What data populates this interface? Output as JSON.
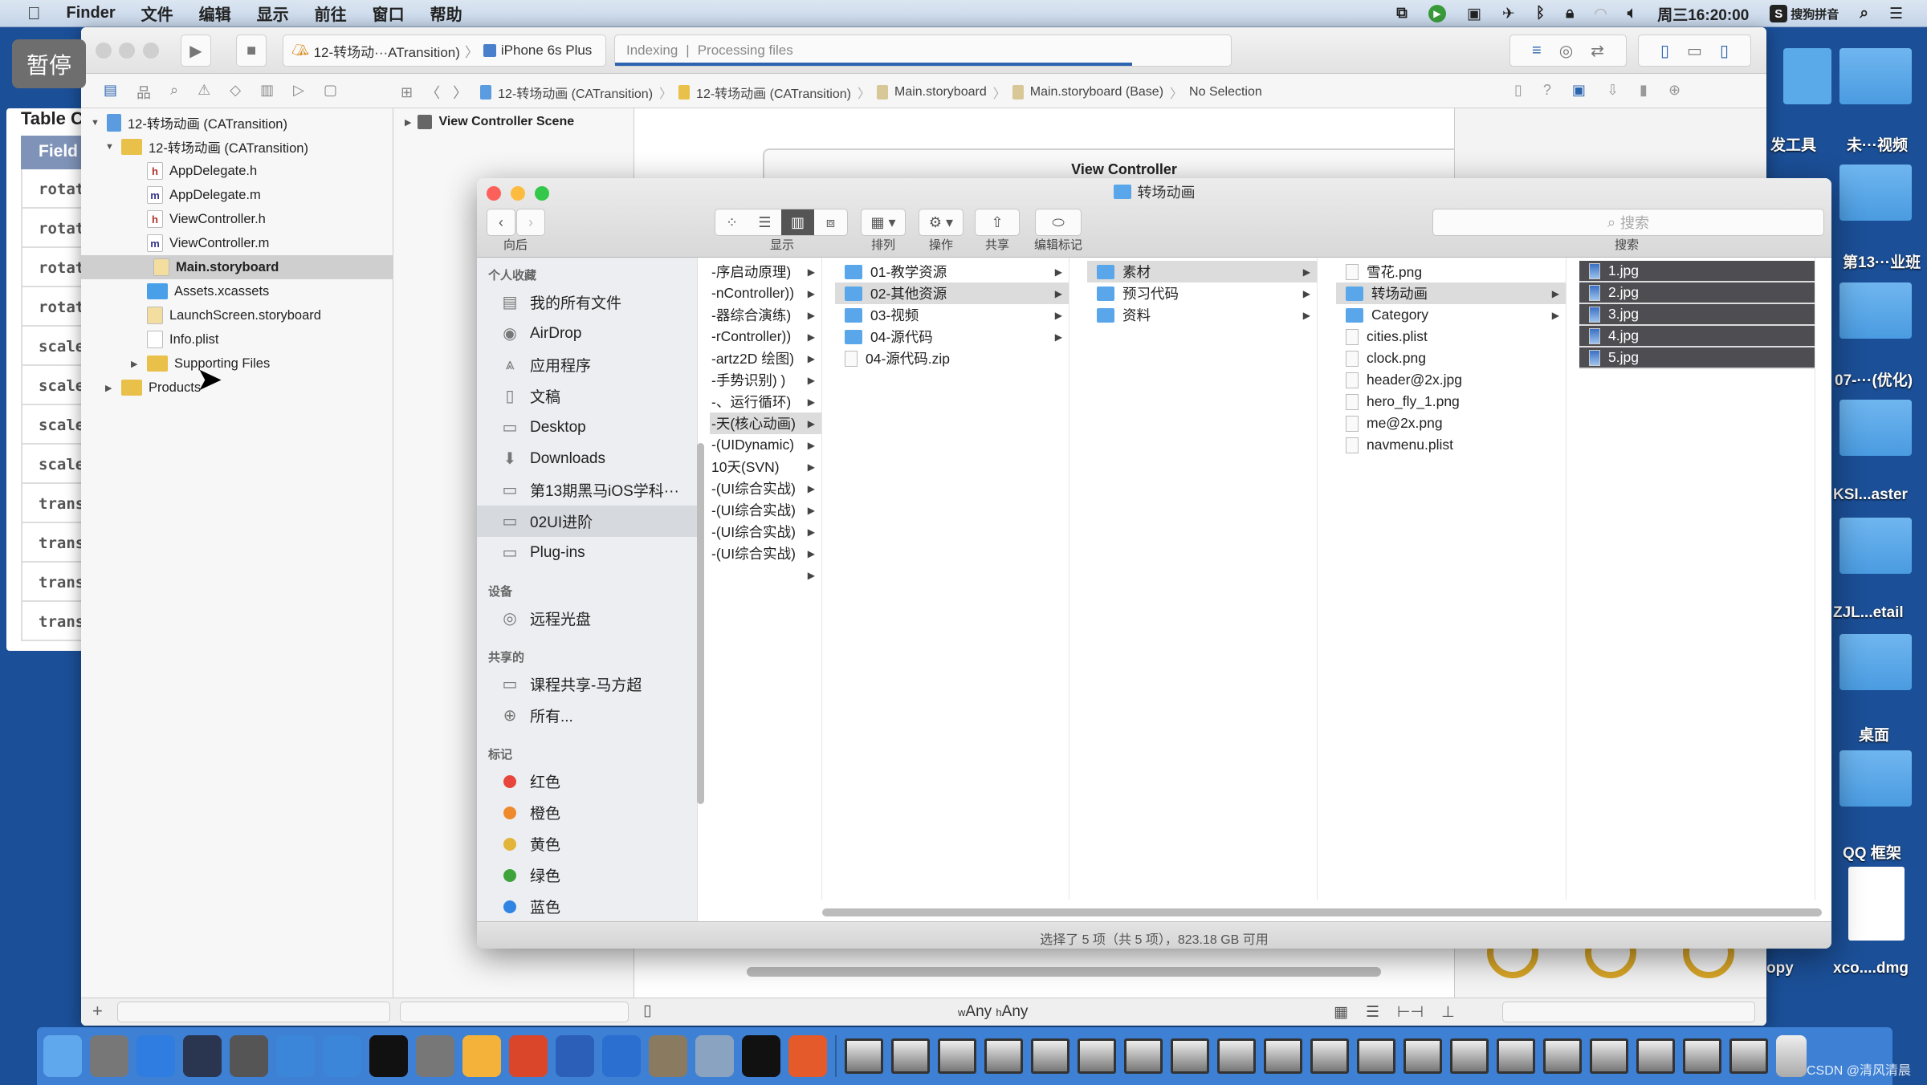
{
  "menubar": {
    "app": "Finder",
    "items": [
      "文件",
      "编辑",
      "显示",
      "前往",
      "窗口",
      "帮助"
    ],
    "clock": "周三16:20:00",
    "input_method": "搜狗拼音"
  },
  "pause_overlay": "暂停",
  "back_window": {
    "title": "Table C",
    "header": "Field",
    "rows": [
      "rotat.",
      "rotat.",
      "rotat.",
      "rotat.",
      "scale",
      "scale",
      "scale",
      "scale",
      "trans.",
      "trans.",
      "trans.",
      "transla"
    ]
  },
  "xcode": {
    "scheme": "12-转场动···ATransition)",
    "device": "iPhone 6s Plus",
    "activity": "Indexing",
    "activity_detail": "Processing files",
    "activity_progress": 0.84,
    "breadcrumb": [
      "12-转场动画 (CATransition)",
      "12-转场动画 (CATransition)",
      "Main.storyboard",
      "Main.storyboard (Base)",
      "No Selection"
    ],
    "tree": [
      {
        "label": "12-转场动画 (CATransition)",
        "level": 0,
        "icon": "project",
        "disclosure": "open"
      },
      {
        "label": "12-转场动画 (CATransition)",
        "level": 1,
        "icon": "folder",
        "disclosure": "open"
      },
      {
        "label": "AppDelegate.h",
        "level": 2,
        "icon": "h"
      },
      {
        "label": "AppDelegate.m",
        "level": 2,
        "icon": "m"
      },
      {
        "label": "ViewController.h",
        "level": 2,
        "icon": "h"
      },
      {
        "label": "ViewController.m",
        "level": 2,
        "icon": "m"
      },
      {
        "label": "Main.storyboard",
        "level": 2,
        "icon": "storyboard",
        "selected": true
      },
      {
        "label": "Assets.xcassets",
        "level": 2,
        "icon": "assets"
      },
      {
        "label": "LaunchScreen.storyboard",
        "level": 2,
        "icon": "storyboard"
      },
      {
        "label": "Info.plist",
        "level": 2,
        "icon": "plist"
      },
      {
        "label": "Supporting Files",
        "level": 2,
        "icon": "folder",
        "disclosure": "closed"
      },
      {
        "label": "Products",
        "level": 1,
        "icon": "folder",
        "disclosure": "closed"
      }
    ],
    "outline_scene": "View Controller Scene",
    "canvas_title": "View Controller",
    "size_w": "Any",
    "size_h": "Any"
  },
  "finder": {
    "title": "转场动画",
    "toolbar": {
      "back": "向后",
      "view": "显示",
      "arrange": "排列",
      "action": "操作",
      "share": "共享",
      "tags": "编辑标记",
      "search": "搜索"
    },
    "search_placeholder": "搜索",
    "sidebar": [
      {
        "header": "个人收藏",
        "items": [
          {
            "label": "我的所有文件",
            "icon": "all-files"
          },
          {
            "label": "AirDrop",
            "icon": "airdrop"
          },
          {
            "label": "应用程序",
            "icon": "applications"
          },
          {
            "label": "文稿",
            "icon": "documents"
          },
          {
            "label": "Desktop",
            "icon": "desktop"
          },
          {
            "label": "Downloads",
            "icon": "downloads"
          },
          {
            "label": "第13期黑马iOS学科···",
            "icon": "folder"
          },
          {
            "label": "02UI进阶",
            "icon": "folder",
            "selected": true
          },
          {
            "label": "Plug-ins",
            "icon": "folder"
          }
        ]
      },
      {
        "header": "设备",
        "items": [
          {
            "label": "远程光盘",
            "icon": "disc"
          }
        ]
      },
      {
        "header": "共享的",
        "items": [
          {
            "label": "课程共享-马方超",
            "icon": "computer"
          },
          {
            "label": "所有...",
            "icon": "network"
          }
        ]
      },
      {
        "header": "标记",
        "items": [
          {
            "label": "红色",
            "color": "#e8453c"
          },
          {
            "label": "橙色",
            "color": "#ef8a2c"
          },
          {
            "label": "黄色",
            "color": "#e3b43a"
          },
          {
            "label": "绿色",
            "color": "#3fa33c"
          },
          {
            "label": "蓝色",
            "color": "#2f84e4"
          }
        ]
      }
    ],
    "columns": [
      [
        {
          "label": "-序启动原理)",
          "arrow": true
        },
        {
          "label": "-nController))",
          "arrow": true
        },
        {
          "label": "-器综合演练)",
          "arrow": true
        },
        {
          "label": "-rController))",
          "arrow": true
        },
        {
          "label": "-artz2D 绘图)",
          "arrow": true
        },
        {
          "label": "-手势识别) )",
          "arrow": true
        },
        {
          "label": "-、运行循环)",
          "arrow": true
        },
        {
          "label": "-天(核心动画)",
          "arrow": true,
          "selected": true
        },
        {
          "label": "-(UIDynamic)",
          "arrow": true
        },
        {
          "label": "10天(SVN)",
          "arrow": true
        },
        {
          "label": "-(UI综合实战)",
          "arrow": true
        },
        {
          "label": "-(UI综合实战)",
          "arrow": true
        },
        {
          "label": "-(UI综合实战)",
          "arrow": true
        },
        {
          "label": "-(UI综合实战)",
          "arrow": true
        },
        {
          "label": "",
          "arrow": true
        }
      ],
      [
        {
          "label": "01-教学资源",
          "type": "folder",
          "arrow": true
        },
        {
          "label": "02-其他资源",
          "type": "folder",
          "arrow": true,
          "selected": true
        },
        {
          "label": "03-视频",
          "type": "folder",
          "arrow": true
        },
        {
          "label": "04-源代码",
          "type": "folder",
          "arrow": true
        },
        {
          "label": "04-源代码.zip",
          "type": "file"
        }
      ],
      [
        {
          "label": "素材",
          "type": "folder",
          "arrow": true,
          "selected": true
        },
        {
          "label": "预习代码",
          "type": "folder",
          "arrow": true
        },
        {
          "label": "资料",
          "type": "folder",
          "arrow": true
        }
      ],
      [
        {
          "label": "雪花.png",
          "type": "file"
        },
        {
          "label": "转场动画",
          "type": "folder",
          "arrow": true,
          "selected": true
        },
        {
          "label": "Category",
          "type": "folder",
          "arrow": true
        },
        {
          "label": "cities.plist",
          "type": "file"
        },
        {
          "label": "clock.png",
          "type": "file"
        },
        {
          "label": "header@2x.jpg",
          "type": "file"
        },
        {
          "label": "hero_fly_1.png",
          "type": "file"
        },
        {
          "label": "me@2x.png",
          "type": "file"
        },
        {
          "label": "navmenu.plist",
          "type": "file"
        }
      ],
      [
        {
          "label": "1.jpg",
          "type": "image",
          "selected": true
        },
        {
          "label": "2.jpg",
          "type": "image",
          "selected": true
        },
        {
          "label": "3.jpg",
          "type": "image",
          "selected": true
        },
        {
          "label": "4.jpg",
          "type": "image",
          "selected": true
        },
        {
          "label": "5.jpg",
          "type": "image",
          "selected": true
        }
      ]
    ],
    "status": "选择了 5 项（共 5 项），823.18 GB 可用"
  },
  "desktop": [
    "发工具",
    "未···视频",
    "第13···业班",
    "07-···(优化)",
    "KSI...aster",
    "ZJL...etail",
    "桌面",
    "QQ 框架",
    "xco....dmg",
    "opy"
  ],
  "dock": [
    "finder",
    "launchpad",
    "safari",
    "mouse",
    "imovie",
    "xcode",
    "simulator",
    "terminal",
    "system-preferences",
    "sketch",
    "powerpoint",
    "quicktime",
    "teamviewer",
    "calculator",
    "preview",
    "console",
    "player"
  ],
  "watermark": "CSDN @清风清晨"
}
